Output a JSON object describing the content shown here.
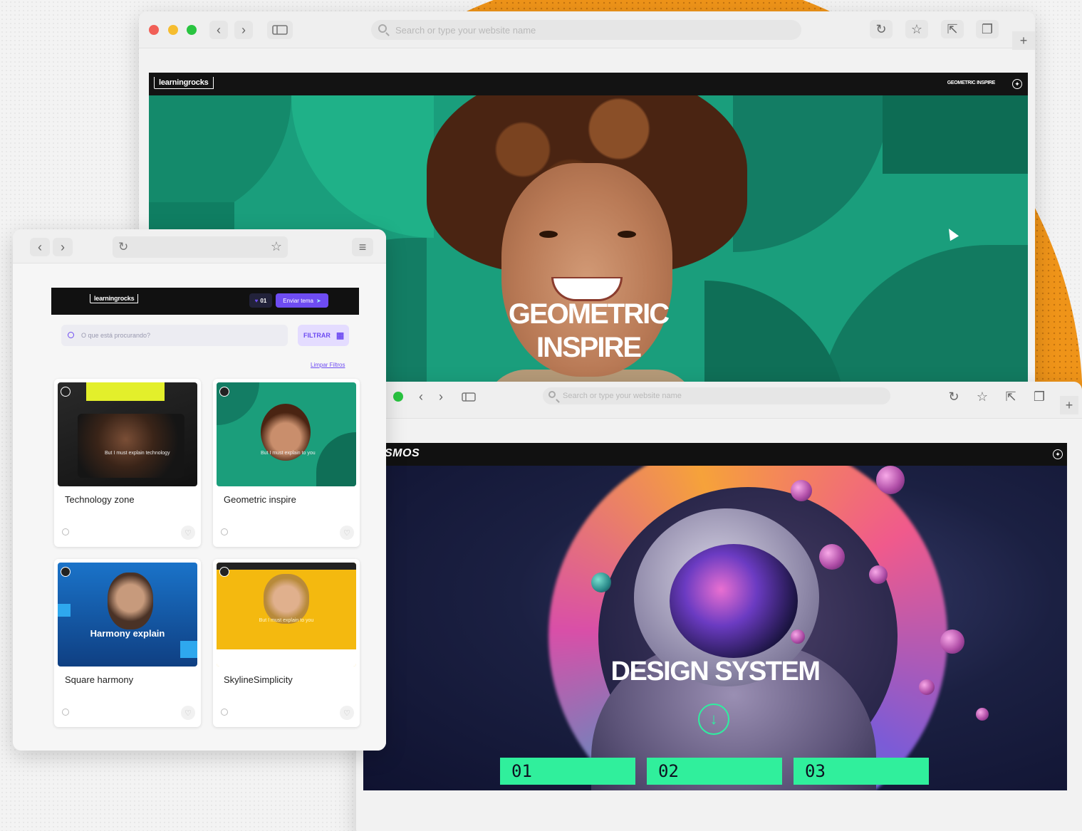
{
  "browser_main": {
    "address_placeholder": "Search or type your website name",
    "site": {
      "logo": "learningrocks",
      "nav_label": "GEOMETRIC INSPIRE",
      "hero_title_line1": "GEOMETRIC",
      "hero_title_line2": "INSPIRE"
    }
  },
  "browser_space": {
    "address_placeholder": "Search or type your website name",
    "site": {
      "logo": "SMOS",
      "hero_title": "DESIGN SYSTEM",
      "tabs": [
        "01",
        "02",
        "03"
      ]
    }
  },
  "browser_catalog": {
    "site": {
      "logo": "learningrocks",
      "favorites_count": "01",
      "send_button": "Enviar tema",
      "search_placeholder": "O que está procurando?",
      "filter_button": "FILTRAR",
      "clear_filters": "Limpar Filtros"
    },
    "cards": [
      {
        "title": "Technology zone",
        "thumb_text": "But I must explain technology"
      },
      {
        "title": "Geometric inspire",
        "thumb_text": "But I must explain to you"
      },
      {
        "title": "Square harmony",
        "thumb_text": "Harmony explain"
      },
      {
        "title": "SkylineSimplicity",
        "thumb_text": "But I must explain to you"
      }
    ]
  },
  "colors": {
    "accent_orange": "#ef9419",
    "geometric_green": "#1a9e7c",
    "neon_green": "#30ef9c",
    "purple": "#6e4cf2"
  }
}
